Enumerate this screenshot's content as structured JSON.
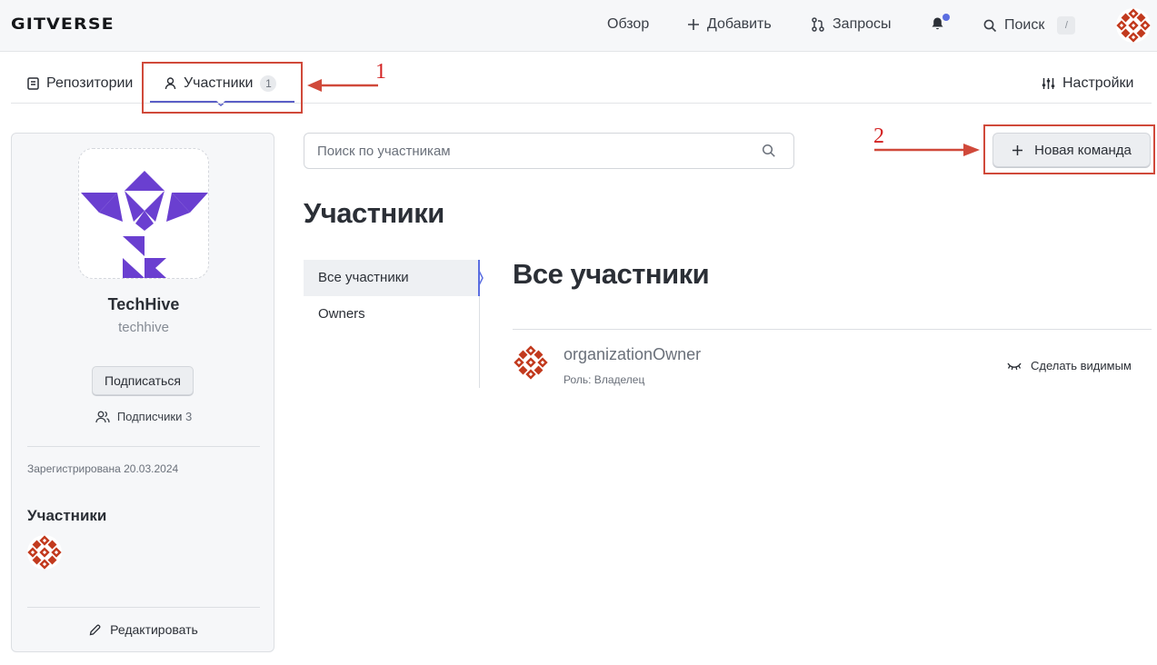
{
  "header": {
    "logo": "GITVERSE",
    "nav": {
      "overview": "Обзор",
      "add": "Добавить",
      "requests": "Запросы",
      "search": "Поиск",
      "search_shortcut": "/"
    }
  },
  "tabs": {
    "repositories": "Репозитории",
    "members": "Участники",
    "members_count": "1",
    "settings": "Настройки"
  },
  "annotations": {
    "label_1": "1",
    "label_2": "2",
    "color": "#d0493a"
  },
  "org": {
    "name": "TechHive",
    "login": "techhive",
    "subscribe": "Подписаться",
    "followers_label": "Подписчики",
    "followers_count": "3",
    "registered": "Зарегистрирована 20.03.2024",
    "members_heading": "Участники",
    "edit": "Редактировать",
    "logo_color": "#6a3fd0"
  },
  "search": {
    "placeholder": "Поиск по участникам"
  },
  "new_team_button": "Новая команда",
  "page_title": "Участники",
  "menu": {
    "all": "Все участники",
    "owners": "Owners"
  },
  "section_title": "Все участники",
  "members": [
    {
      "name": "organizationOwner",
      "role": "Роль: Владелец",
      "action": "Сделать видимым"
    }
  ],
  "colors": {
    "accent": "#5b6ee1",
    "avatar": "#c23a1e"
  }
}
